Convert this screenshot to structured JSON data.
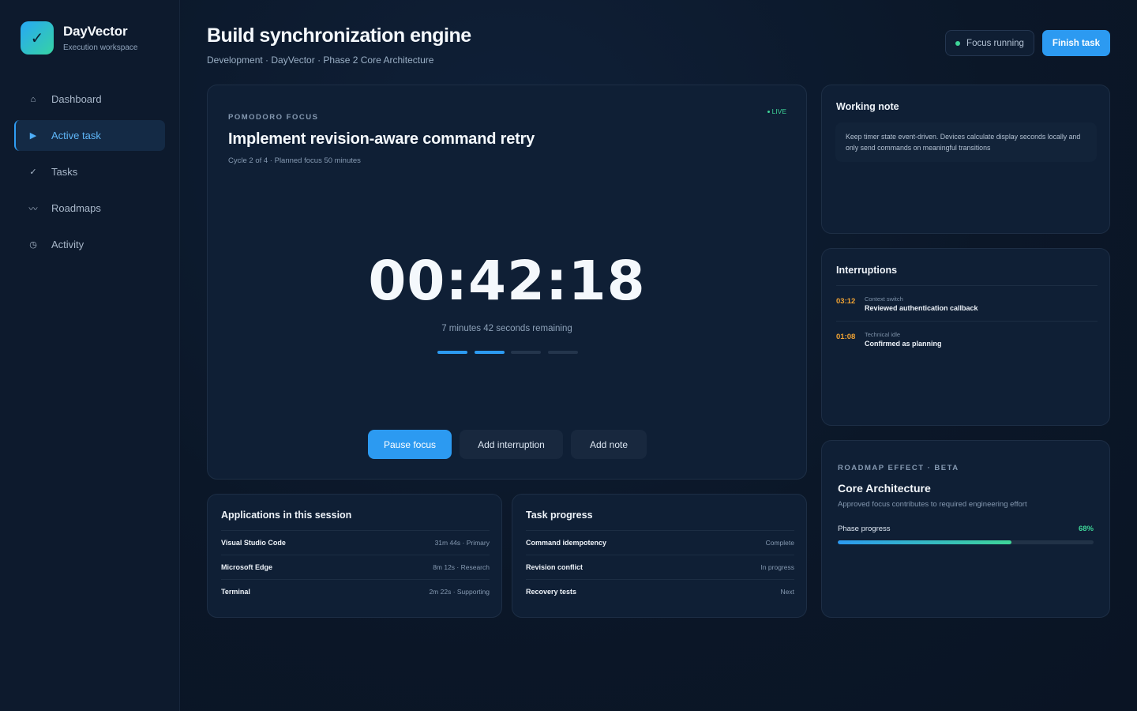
{
  "brand": {
    "name": "DayVector",
    "subtitle": "Execution workspace",
    "logo_icon": "✓"
  },
  "nav": [
    {
      "label": "Dashboard",
      "icon": "home-icon",
      "glyph": "⌂",
      "active": false
    },
    {
      "label": "Active task",
      "icon": "play-icon",
      "glyph": "▶",
      "active": true
    },
    {
      "label": "Tasks",
      "icon": "check-icon",
      "glyph": "✓",
      "active": false
    },
    {
      "label": "Roadmaps",
      "icon": "roadmap-icon",
      "glyph": "〰",
      "active": false
    },
    {
      "label": "Activity",
      "icon": "clock-icon",
      "glyph": "◷",
      "active": false
    }
  ],
  "header": {
    "title": "Build synchronization engine",
    "breadcrumb": "Development · DayVector · Phase 2 Core Architecture",
    "status": "Focus running",
    "finish_label": "Finish task"
  },
  "focus": {
    "eyebrow": "POMODORO FOCUS",
    "live": "LIVE",
    "title": "Implement revision-aware command retry",
    "meta": "Cycle 2 of 4 · Planned focus 50 minutes",
    "timer": "00:42:18",
    "remaining": "7 minutes 42 seconds remaining",
    "cycles_total": 4,
    "cycles_done": 2,
    "actions": {
      "pause": "Pause focus",
      "interruption": "Add interruption",
      "note": "Add note"
    }
  },
  "working_note": {
    "title": "Working note",
    "text": "Keep timer state event-driven. Devices calculate display seconds locally and only send commands on meaningful transitions"
  },
  "interruptions": {
    "title": "Interruptions",
    "items": [
      {
        "time": "03:12",
        "type": "Context switch",
        "desc": "Reviewed authentication callback"
      },
      {
        "time": "01:08",
        "type": "Technical idle",
        "desc": "Confirmed as planning"
      }
    ]
  },
  "roadmap": {
    "eyebrow": "ROADMAP EFFECT · BETA",
    "title": "Core Architecture",
    "subtitle": "Approved focus contributes to required engineering effort",
    "phase_label": "Phase progress",
    "phase_value": "68%",
    "phase_fraction": 0.68
  },
  "apps": {
    "title": "Applications in this session",
    "rows": [
      {
        "name": "Visual Studio Code",
        "value": "31m 44s · Primary"
      },
      {
        "name": "Microsoft Edge",
        "value": "8m 12s · Research"
      },
      {
        "name": "Terminal",
        "value": "2m 22s · Supporting"
      }
    ]
  },
  "progress": {
    "title": "Task progress",
    "rows": [
      {
        "name": "Command idempotency",
        "value": "Complete"
      },
      {
        "name": "Revision conflict",
        "value": "In progress"
      },
      {
        "name": "Recovery tests",
        "value": "Next"
      }
    ]
  }
}
